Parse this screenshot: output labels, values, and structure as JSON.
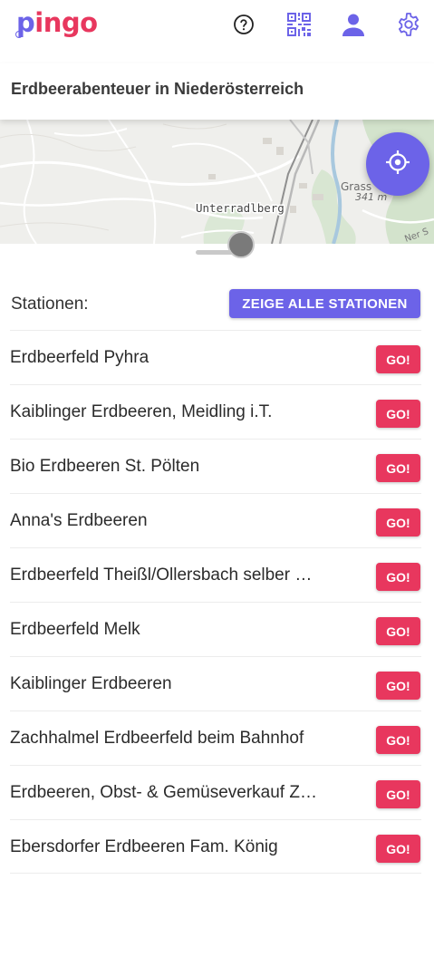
{
  "app": {
    "logo_part1": "p",
    "logo_part2": "ingo"
  },
  "toolbar": {
    "icons": [
      "help-icon",
      "qr-code-icon",
      "user-icon",
      "settings-icon"
    ],
    "accent_color": "#6c63e8"
  },
  "page": {
    "title": "Erdbeerabenteuer in Niederösterreich"
  },
  "map": {
    "labels": [
      "Unterradlberg",
      "Grass",
      "341 m",
      "Ner S"
    ]
  },
  "stations": {
    "label": "Stationen:",
    "show_all_label": "ZEIGE ALLE STATIONEN",
    "go_color": "#e8375e",
    "items": [
      {
        "name": "Erdbeerfeld Pyhra",
        "go_label": "GO!"
      },
      {
        "name": "Kaiblinger Erdbeeren, Meidling i.T.",
        "go_label": "GO!"
      },
      {
        "name": "Bio Erdbeeren St. Pölten",
        "go_label": "GO!"
      },
      {
        "name": "Anna's Erdbeeren",
        "go_label": "GO!"
      },
      {
        "name": "Erdbeerfeld Theißl/Ollersbach selber …",
        "go_label": "GO!"
      },
      {
        "name": "Erdbeerfeld Melk",
        "go_label": "GO!"
      },
      {
        "name": "Kaiblinger Erdbeeren",
        "go_label": "GO!"
      },
      {
        "name": "Zachhalmel Erdbeerfeld beim Bahnhof",
        "go_label": "GO!"
      },
      {
        "name": "Erdbeeren, Obst- & Gemüseverkauf Z…",
        "go_label": "GO!"
      },
      {
        "name": "Ebersdorfer Erdbeeren Fam. König",
        "go_label": "GO!"
      }
    ]
  }
}
